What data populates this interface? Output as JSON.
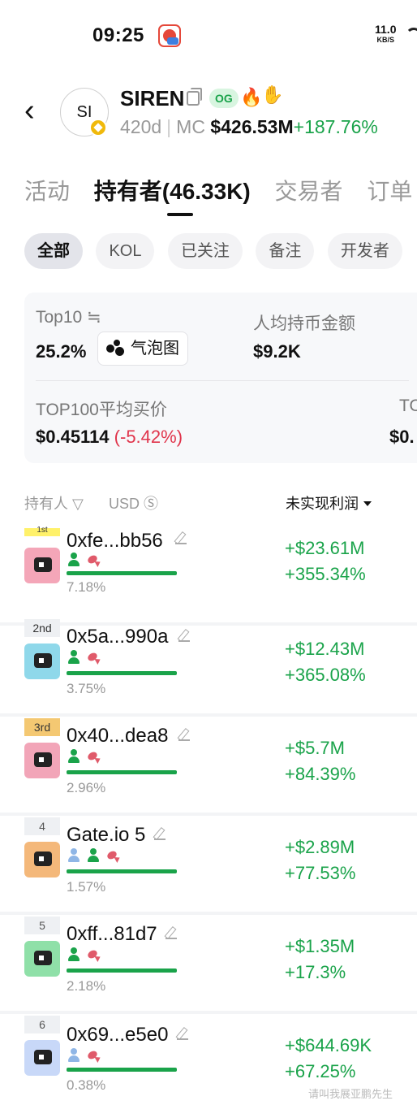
{
  "status_bar": {
    "time": "09:25",
    "net_speed": "11.0",
    "net_unit": "KB/S"
  },
  "token": {
    "avatar_text": "SI",
    "name": "SIREN",
    "og_tag": "OG",
    "age": "420d",
    "mc_label": "MC",
    "mc_value": "$426.53M",
    "mc_change": "+187.76%"
  },
  "tabs": [
    {
      "label": "活动"
    },
    {
      "label": "持有者(46.33K)"
    },
    {
      "label": "交易者"
    },
    {
      "label": "订单"
    }
  ],
  "filters": [
    {
      "label": "全部"
    },
    {
      "label": "KOL"
    },
    {
      "label": "已关注"
    },
    {
      "label": "备注"
    },
    {
      "label": "开发者"
    }
  ],
  "stats": {
    "top10_label": "Top10 ≒",
    "top10_value": "25.2%",
    "bubble_label": "气泡图",
    "avg_label": "人均持币金额",
    "avg_value": "$9.2K",
    "top100_label": "TOP100平均买价",
    "top100_value": "$0.45114",
    "top100_change": "(-5.42%)",
    "extra_label": "TO",
    "extra_value": "$0."
  },
  "list_header": {
    "holder": "持有人",
    "usd": "USD",
    "pnl": "未实现利润"
  },
  "holders": [
    {
      "rank": "1st",
      "address": "0xfe...bb56",
      "pct": "7.18%",
      "progress": 0.0718,
      "pnl_abs": "+$23.61M",
      "pnl_pct": "+355.34%",
      "avatar_color": "#f4a6b8"
    },
    {
      "rank": "2nd",
      "address": "0x5a...990a",
      "pct": "3.75%",
      "progress": 0.0375,
      "pnl_abs": "+$12.43M",
      "pnl_pct": "+365.08%",
      "avatar_color": "#8fd8ea"
    },
    {
      "rank": "3rd",
      "address": "0x40...dea8",
      "pct": "2.96%",
      "progress": 0.0296,
      "pnl_abs": "+$5.7M",
      "pnl_pct": "+84.39%",
      "avatar_color": "#f2a5b8"
    },
    {
      "rank": "4",
      "address": "Gate.io 5",
      "pct": "1.57%",
      "progress": 0.0157,
      "pnl_abs": "+$2.89M",
      "pnl_pct": "+77.53%",
      "avatar_color": "#f4b87a"
    },
    {
      "rank": "5",
      "address": "0xff...81d7",
      "pct": "2.18%",
      "progress": 0.0218,
      "pnl_abs": "+$1.35M",
      "pnl_pct": "+17.3%",
      "avatar_color": "#8fe0a8"
    },
    {
      "rank": "6",
      "address": "0x69...e5e0",
      "pct": "0.38%",
      "progress": 0.0038,
      "pnl_abs": "+$644.69K",
      "pnl_pct": "+67.25%",
      "avatar_color": "#c8d8f8"
    }
  ],
  "watermark": "请叫我展亚鹏先生"
}
